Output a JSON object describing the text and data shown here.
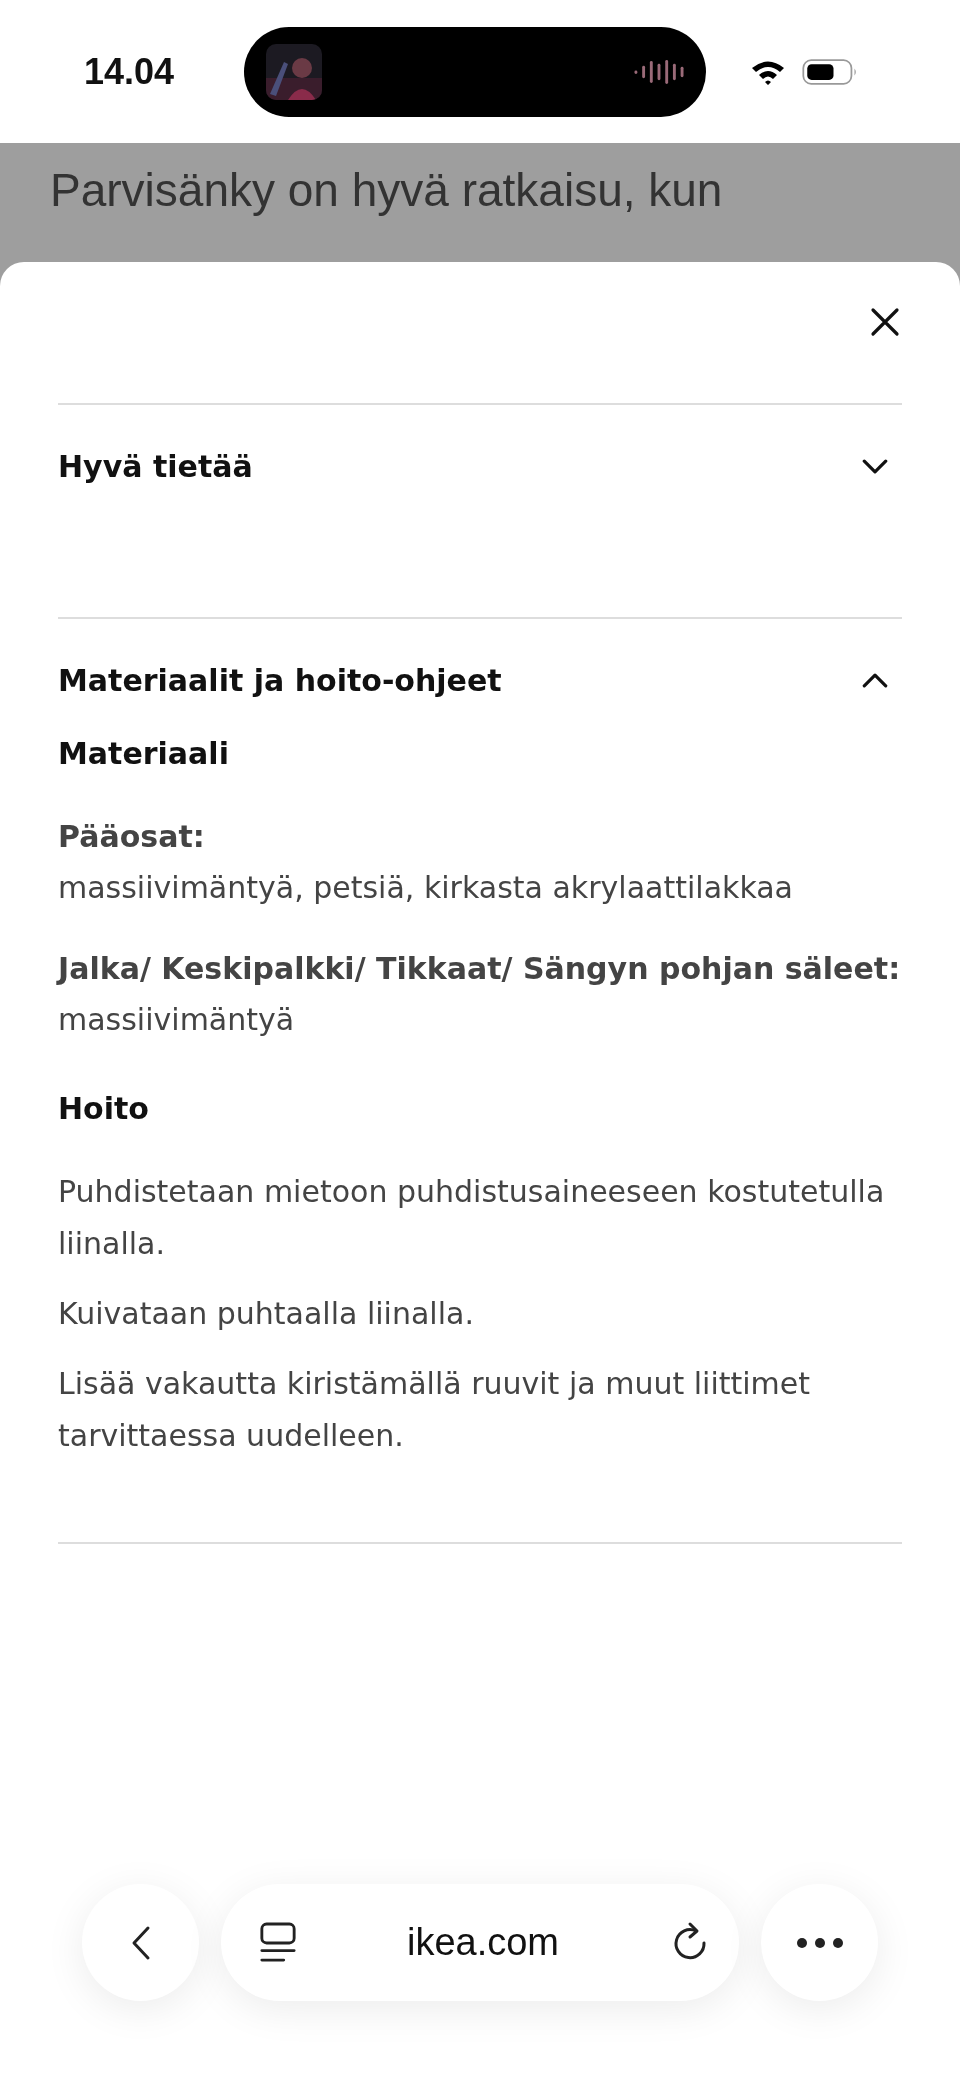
{
  "status_bar": {
    "time": "14.04"
  },
  "background_text": "Parvisänky on hyvä ratkaisu, kun",
  "sections": [
    {
      "title": "Hyvä tietää",
      "expanded": false
    },
    {
      "title": "Materiaalit ja hoito-ohjeet",
      "expanded": true,
      "blocks": [
        {
          "kind": "materials",
          "heading": "Materiaali",
          "items": [
            {
              "label": "Pääosat:",
              "value": "massiivimäntyä, petsiä, kirkasta akrylaattilakkaa"
            },
            {
              "label": "Jalka/ Keskipalkki/ Tikkaat/ Sängyn pohjan säleet:",
              "value": "massiivimäntyä"
            }
          ]
        },
        {
          "kind": "care",
          "heading": "Hoito",
          "paragraphs": [
            "Puhdistetaan mietoon puhdistusaineeseen kostutetulla liinalla.",
            "Kuivataan puhtaalla liinalla.",
            "Lisää vakautta kiristämällä ruuvit ja muut liittimet tarvittaessa uudelleen."
          ]
        }
      ]
    }
  ],
  "browser_bar": {
    "url": "ikea.com"
  }
}
